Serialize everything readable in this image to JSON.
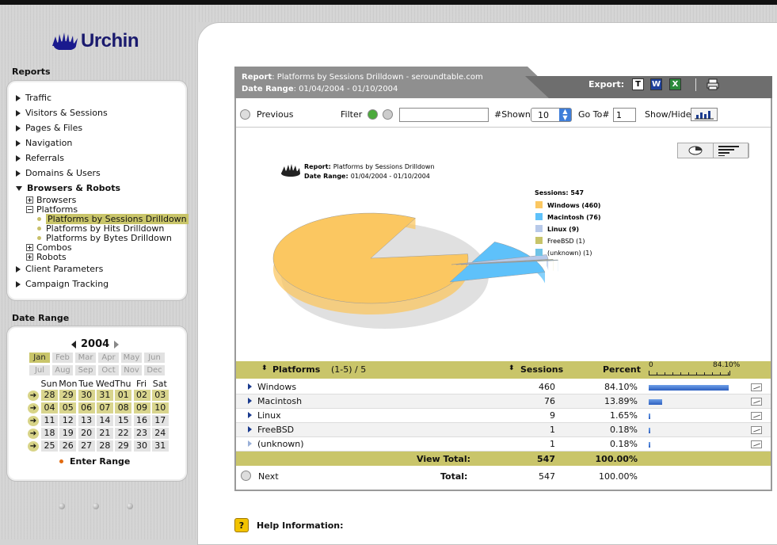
{
  "app": {
    "name": "Urchin"
  },
  "sidebar": {
    "reports_title": "Reports",
    "nav": [
      {
        "label": "Traffic"
      },
      {
        "label": "Visitors & Sessions"
      },
      {
        "label": "Pages & Files"
      },
      {
        "label": "Navigation"
      },
      {
        "label": "Referrals"
      },
      {
        "label": "Domains & Users"
      },
      {
        "label": "Browsers & Robots"
      },
      {
        "label": "Client Parameters"
      },
      {
        "label": "Campaign Tracking"
      }
    ],
    "sub": [
      {
        "label": "Browsers"
      },
      {
        "label": "Platforms"
      },
      {
        "label": "Combos"
      },
      {
        "label": "Robots"
      }
    ],
    "leaves": [
      {
        "label": "Platforms by Sessions Drilldown",
        "selected": true
      },
      {
        "label": "Platforms by Hits Drilldown"
      },
      {
        "label": "Platforms by Bytes Drilldown"
      }
    ],
    "date_range_title": "Date Range",
    "calendar": {
      "year": "2004",
      "months": [
        "Jan",
        "Feb",
        "Mar",
        "Apr",
        "May",
        "Jun",
        "Jul",
        "Aug",
        "Sep",
        "Oct",
        "Nov",
        "Dec"
      ],
      "active_month": "Jan",
      "days_of_week": [
        "Sun",
        "Mon",
        "Tue",
        "Wed",
        "Thu",
        "Fri",
        "Sat"
      ],
      "weeks": [
        [
          "28",
          "29",
          "30",
          "31",
          "01",
          "02",
          "03"
        ],
        [
          "04",
          "05",
          "06",
          "07",
          "08",
          "09",
          "10"
        ],
        [
          "11",
          "12",
          "13",
          "14",
          "15",
          "16",
          "17"
        ],
        [
          "18",
          "19",
          "20",
          "21",
          "22",
          "23",
          "24"
        ],
        [
          "25",
          "26",
          "27",
          "28",
          "29",
          "30",
          "31"
        ]
      ],
      "week_marker": "➔"
    },
    "enter_range": "Enter Range"
  },
  "report": {
    "report_label": "Report",
    "report_title": "Platforms by Sessions Drilldown - seroundtable.com",
    "date_label": "Date Range",
    "date_range": "01/04/2004 - 01/10/2004",
    "export_label": "Export:",
    "export_icons": [
      "T",
      "W",
      "X"
    ]
  },
  "toolbar": {
    "previous": "Previous",
    "filter": "Filter",
    "filter_value": "",
    "shown_label": "#Shown",
    "shown_value": "10",
    "goto_label": "Go To#",
    "goto_value": "1",
    "showhide": "Show/Hide"
  },
  "chart_data": {
    "type": "pie",
    "report_label": "Report:",
    "report_title": "Platforms by Sessions Drilldown",
    "date_label": "Date Range:",
    "date_range": "01/04/2004 - 01/10/2004",
    "legend_title": "Sessions: 547",
    "categories": [
      "Windows (460)",
      "Macintosh (76)",
      "Linux (9)",
      "FreeBSD (1)",
      "(unknown) (1)"
    ],
    "values": [
      460,
      76,
      9,
      1,
      1
    ],
    "colors": [
      "#fbc761",
      "#5ec1fa",
      "#b7c9e9",
      "#c7c46a",
      "#6fc3e6"
    ]
  },
  "table": {
    "col_platforms": "Platforms",
    "range": "(1-5) / 5",
    "col_sessions": "Sessions",
    "col_percent": "Percent",
    "scale_min": "0",
    "scale_max": "84.10%",
    "rows": [
      {
        "name": "Windows",
        "sessions": "460",
        "percent": "84.10%",
        "pct": 84.1
      },
      {
        "name": "Macintosh",
        "sessions": "76",
        "percent": "13.89%",
        "pct": 13.89
      },
      {
        "name": "Linux",
        "sessions": "9",
        "percent": "1.65%",
        "pct": 1.65
      },
      {
        "name": "FreeBSD",
        "sessions": "1",
        "percent": "0.18%",
        "pct": 0.18
      },
      {
        "name": "(unknown)",
        "sessions": "1",
        "percent": "0.18%",
        "pct": 0.18
      }
    ],
    "view_total_label": "View Total:",
    "view_total_sessions": "547",
    "view_total_percent": "100.00%",
    "next": "Next",
    "total_label": "Total:",
    "total_sessions": "547",
    "total_percent": "100.00%"
  },
  "help": {
    "label": "Help Information:",
    "icon": "?"
  }
}
